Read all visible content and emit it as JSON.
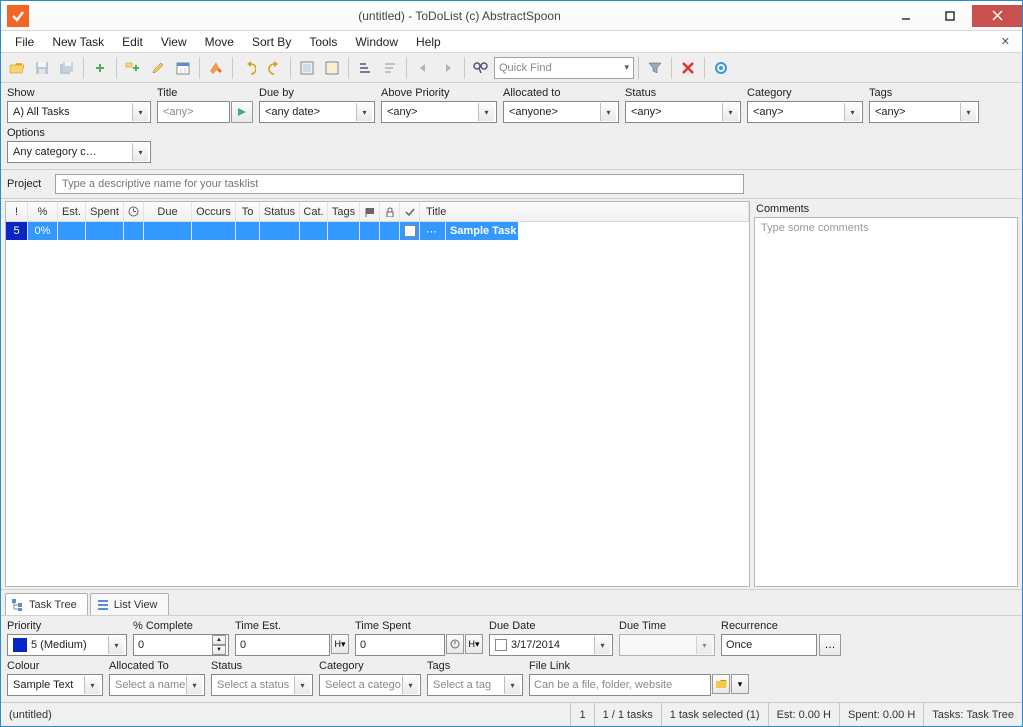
{
  "window": {
    "title": "(untitled) - ToDoList (c) AbstractSpoon"
  },
  "menu": {
    "file": "File",
    "new_task": "New Task",
    "edit": "Edit",
    "view": "View",
    "move": "Move",
    "sort_by": "Sort By",
    "tools": "Tools",
    "window": "Window",
    "help": "Help"
  },
  "toolbar": {
    "quick_find_placeholder": "Quick Find"
  },
  "filters": {
    "show": {
      "label": "Show",
      "value": "A)  All Tasks"
    },
    "title": {
      "label": "Title",
      "value": "<any>"
    },
    "due_by": {
      "label": "Due by",
      "value": "<any date>"
    },
    "above_priority": {
      "label": "Above Priority",
      "value": "<any>"
    },
    "allocated_to": {
      "label": "Allocated to",
      "value": "<anyone>"
    },
    "status": {
      "label": "Status",
      "value": "<any>"
    },
    "category": {
      "label": "Category",
      "value": "<any>"
    },
    "tags": {
      "label": "Tags",
      "value": "<any>"
    },
    "options": {
      "label": "Options",
      "value": "Any category c…"
    }
  },
  "project": {
    "label": "Project",
    "placeholder": "Type a descriptive name for your tasklist"
  },
  "comments": {
    "label": "Comments",
    "placeholder": "Type some comments"
  },
  "columns": {
    "priority": "!",
    "percent": "%",
    "est": "Est.",
    "spent": "Spent",
    "reminder": "⏰",
    "due": "Due",
    "occurs": "Occurs",
    "to": "To",
    "status": "Status",
    "cat": "Cat.",
    "tags": "Tags",
    "flag": "⚑",
    "lock": "🔒",
    "check": "✔",
    "title": "Title"
  },
  "tasks": [
    {
      "priority": "5",
      "percent": "0%",
      "title": "Sample Task"
    }
  ],
  "tabs": {
    "task_tree": "Task Tree",
    "list_view": "List View"
  },
  "attrs": {
    "priority": {
      "label": "Priority",
      "value": "5 (Medium)"
    },
    "percent_complete": {
      "label": "% Complete",
      "value": "0"
    },
    "time_est": {
      "label": "Time Est.",
      "value": "0",
      "unit": "H"
    },
    "time_spent": {
      "label": "Time Spent",
      "value": "0",
      "unit": "H"
    },
    "due_date": {
      "label": "Due Date",
      "value": "3/17/2014"
    },
    "due_time": {
      "label": "Due Time",
      "value": ""
    },
    "recurrence": {
      "label": "Recurrence",
      "value": "Once"
    },
    "colour": {
      "label": "Colour",
      "value": "Sample Text"
    },
    "allocated_to": {
      "label": "Allocated To",
      "value": "Select a name"
    },
    "status": {
      "label": "Status",
      "value": "Select a status"
    },
    "category": {
      "label": "Category",
      "value": "Select a catego"
    },
    "tags": {
      "label": "Tags",
      "value": "Select a tag"
    },
    "file_link": {
      "label": "File Link",
      "value": "Can be a file, folder, website"
    }
  },
  "status": {
    "doc": "(untitled)",
    "item": "1",
    "counts": "1 / 1 tasks",
    "selected": "1 task selected (1)",
    "est": "Est: 0.00 H",
    "spent": "Spent: 0.00 H",
    "view": "Tasks: Task Tree"
  }
}
